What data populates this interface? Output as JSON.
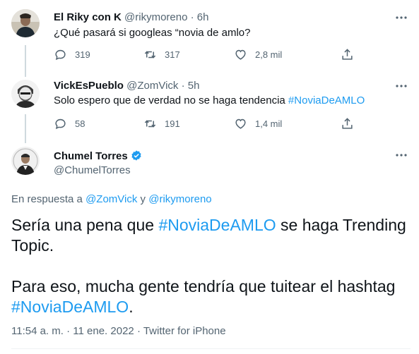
{
  "tweets": [
    {
      "name": "El Riky con K",
      "handle": "@rikymoreno",
      "sep": "·",
      "time": "6h",
      "text": "¿Qué pasará si googleas “novia de amlo?",
      "replies": "319",
      "retweets": "317",
      "likes": "2,8 mil"
    },
    {
      "name": "VickEsPueblo",
      "handle": "@ZomVick",
      "sep": "·",
      "time": "5h",
      "text_before": "Solo espero que de verdad no se haga tendencia ",
      "hashtag": "#NoviaDeAMLO",
      "replies": "58",
      "retweets": "191",
      "likes": "1,4 mil"
    }
  ],
  "main": {
    "name": "Chumel Torres",
    "handle": "@ChumelTorres",
    "reply_prefix": "En respuesta a ",
    "reply_user1": "@ZomVick",
    "reply_and": " y ",
    "reply_user2": "@rikymoreno",
    "line1_before": "Sería una pena que ",
    "line1_hashtag": "#NoviaDeAMLO",
    "line1_after": " se haga Trending",
    "line2": "Topic.",
    "line3": "Para eso, mucha gente tendría que tuitear el hashtag",
    "line4_hashtag": "#NoviaDeAMLO",
    "line4_after": ".",
    "time": "11:54 a. m.",
    "date": "11 ene. 2022",
    "source": "Twitter for iPhone",
    "sep": "·"
  },
  "colors": {
    "accent": "#1d9bf0",
    "muted": "#536471",
    "text": "#0f1419",
    "verified": "#1d9bf0"
  },
  "icons": [
    "more-icon",
    "reply-icon",
    "retweet-icon",
    "like-icon",
    "share-icon",
    "verified-badge-icon"
  ]
}
